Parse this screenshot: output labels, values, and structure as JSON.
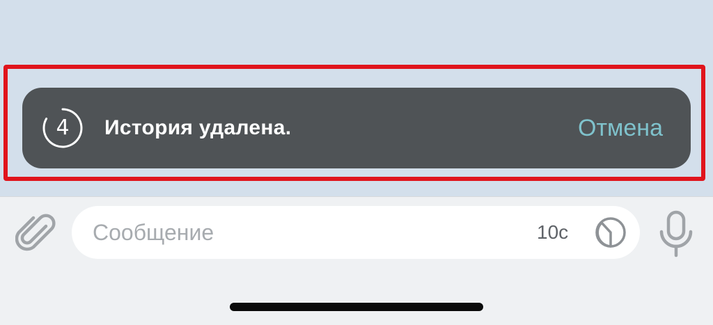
{
  "toast": {
    "countdown": "4",
    "message": "История удалена.",
    "action_label": "Отмена",
    "colors": {
      "background": "#4f5356",
      "text": "#ffffff",
      "action": "#7fc2cc"
    },
    "icon": "countdown-timer-icon"
  },
  "highlight": {
    "color": "#e0141c"
  },
  "composer": {
    "attach_icon": "paperclip-icon",
    "placeholder": "Сообщение",
    "self_destruct_label": "10с",
    "timer_icon": "clock-timer-icon",
    "mic_icon": "microphone-icon"
  },
  "colors": {
    "chat_background": "#d3dfeb",
    "input_bar_background": "#eff1f3",
    "icon_gray": "#a0a4a8"
  }
}
